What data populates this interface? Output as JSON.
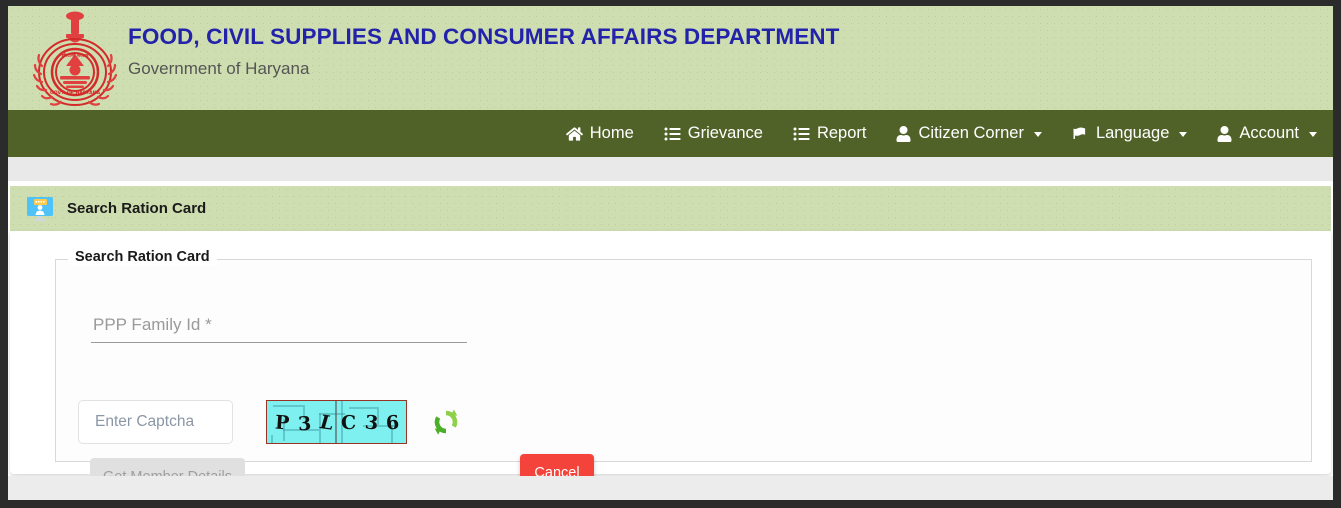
{
  "header": {
    "title": "FOOD, CIVIL SUPPLIES AND CONSUMER AFFAIRS DEPARTMENT",
    "subtitle": "Government of Haryana",
    "emblem_icon": "haryana-government-emblem",
    "title_color": "#2222aa",
    "band_color": "#cedeb0"
  },
  "nav": {
    "background_color": "#506228",
    "items": [
      {
        "label": "Home",
        "icon": "home-icon",
        "has_caret": false
      },
      {
        "label": "Grievance",
        "icon": "list-icon",
        "has_caret": false
      },
      {
        "label": "Report",
        "icon": "list-icon",
        "has_caret": false
      },
      {
        "label": "Citizen Corner",
        "icon": "user-icon",
        "has_caret": true
      },
      {
        "label": "Language",
        "icon": "flag-icon",
        "has_caret": true
      },
      {
        "label": "Account",
        "icon": "user-icon",
        "has_caret": true
      }
    ]
  },
  "page": {
    "title": "Search Ration Card",
    "title_icon": "monitor-user-icon"
  },
  "form": {
    "legend": "Search Ration Card",
    "ppp_family_id": {
      "value": "",
      "placeholder": "PPP Family Id *"
    },
    "captcha_input": {
      "value": "",
      "placeholder": "Enter Captcha"
    },
    "captcha_image": {
      "text": "P3LC36",
      "characters": [
        "P",
        "3",
        "L",
        "C",
        "3",
        "6"
      ],
      "background_color": "#7ef0ef",
      "border_color": "#993322"
    },
    "refresh_icon": "refresh-icon",
    "refresh_icon_color": "#5cb82b",
    "buttons": {
      "submit": {
        "label": "Get Member Details",
        "disabled": true,
        "color": "#e0e0e0"
      },
      "cancel": {
        "label": "Cancel",
        "disabled": false,
        "color": "#f4433a"
      }
    }
  }
}
